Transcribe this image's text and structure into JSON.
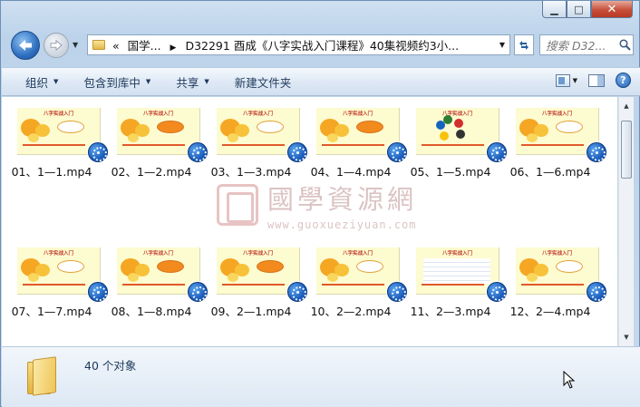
{
  "window": {
    "controls": {
      "minimize": "▁",
      "maximize": "□",
      "close": "✕"
    }
  },
  "nav": {
    "back_icon": "back-arrow-icon",
    "forward_icon": "forward-arrow-icon",
    "address_prefix": "«",
    "address_segments": [
      "国学...",
      "D32291 酉成《八字实战入门课程》40集视频约3小..."
    ],
    "search_placeholder": "搜索 D32..."
  },
  "toolbar": {
    "organize": "组织",
    "include_library": "包含到库中",
    "share": "共享",
    "new_folder": "新建文件夹"
  },
  "thumbnail_title": "八字实战入门",
  "files": [
    {
      "name": "01、1—1.mp4"
    },
    {
      "name": "02、1—2.mp4"
    },
    {
      "name": "03、1—3.mp4"
    },
    {
      "name": "04、1—4.mp4"
    },
    {
      "name": "05、1—5.mp4"
    },
    {
      "name": "06、1—6.mp4"
    },
    {
      "name": "07、1—7.mp4"
    },
    {
      "name": "08、1—8.mp4"
    },
    {
      "name": "09、2—1.mp4"
    },
    {
      "name": "10、2—2.mp4"
    },
    {
      "name": "11、2—3.mp4"
    },
    {
      "name": "12、2—4.mp4"
    }
  ],
  "watermark": {
    "chinese": "國學資源網",
    "url": "www.guoxueziyuan.com"
  },
  "status": {
    "item_count": "40 个对象"
  },
  "colors": {
    "accent": "#1e395b",
    "thumb_bg": "#fdfbd0",
    "badge": "#1858b8"
  }
}
